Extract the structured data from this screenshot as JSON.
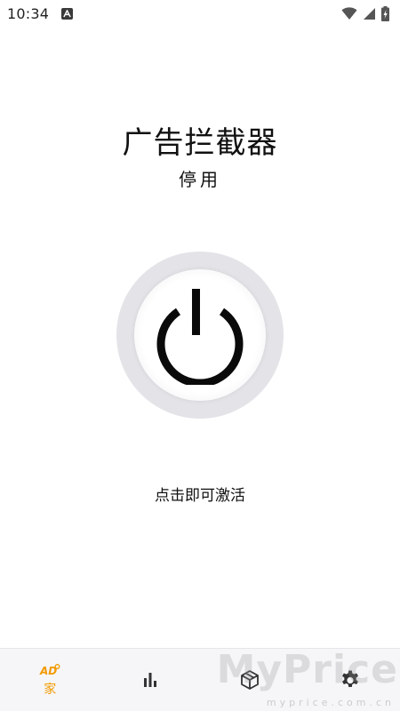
{
  "status_bar": {
    "time": "10:34",
    "app_icon": "a-letter-icon",
    "icons": [
      "wifi-icon",
      "signal-icon",
      "battery-charging-icon"
    ]
  },
  "header": {
    "title": "广告拦截器",
    "state": "停用"
  },
  "power": {
    "icon": "power-icon",
    "hint": "点击即可激活"
  },
  "bottom_nav": {
    "items": [
      {
        "icon": "ad-icon",
        "icon_text": "AD",
        "label": "家",
        "active": true
      },
      {
        "icon": "bar-chart-icon",
        "label": ""
      },
      {
        "icon": "package-icon",
        "label": ""
      },
      {
        "icon": "gear-icon",
        "label": ""
      }
    ]
  },
  "watermark": {
    "text": "MyPrice",
    "subtext": "myprice.com.cn"
  },
  "colors": {
    "accent": "#f29a00",
    "ring": "#e4e4e8",
    "nav_background": "#f6f6f8"
  }
}
